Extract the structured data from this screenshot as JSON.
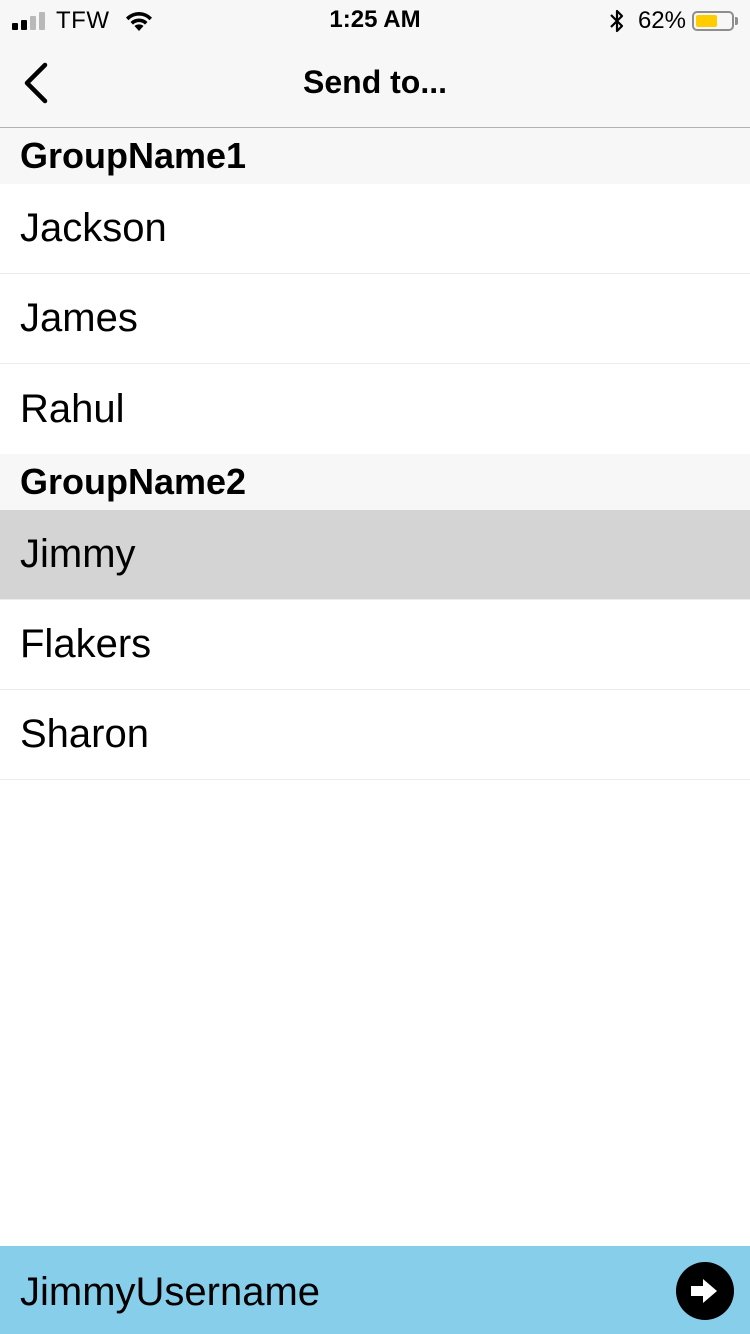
{
  "status_bar": {
    "carrier": "TFW",
    "time": "1:25 AM",
    "battery_percent": "62%",
    "battery_level": 0.62,
    "signal_bars_active": 2,
    "signal_bars_total": 4,
    "icons": [
      "signal-icon",
      "wifi-icon",
      "bluetooth-icon",
      "battery-icon"
    ],
    "battery_color": "#ffcc00"
  },
  "nav": {
    "title": "Send to...",
    "back_icon": "chevron-left-icon"
  },
  "sections": [
    {
      "title": "GroupName1",
      "items": [
        "Jackson",
        "James",
        "Rahul"
      ]
    },
    {
      "title": "GroupName2",
      "items": [
        "Jimmy",
        "Flakers",
        "Sharon"
      ],
      "selected_item": "Jimmy"
    }
  ],
  "bottom_bar": {
    "text": "JimmyUsername",
    "send_icon": "arrow-right-circle-icon",
    "background_color": "#87ceeb"
  }
}
